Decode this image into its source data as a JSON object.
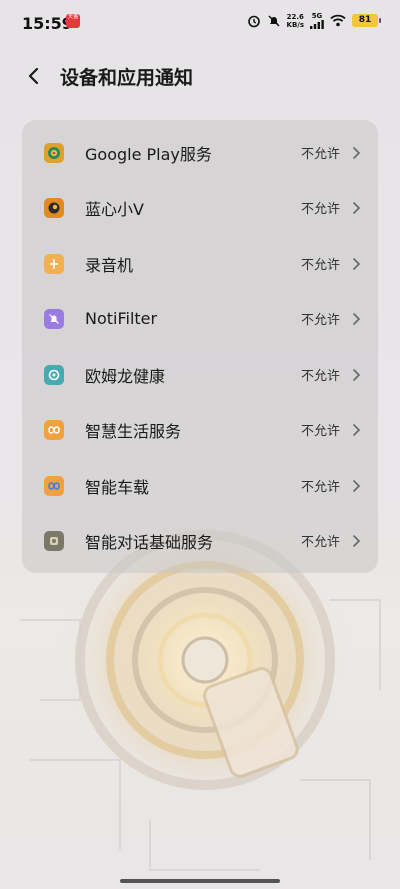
{
  "status_bar": {
    "time": "15:59",
    "notif_app_label": "天猫",
    "net_speed_value": "22.6",
    "net_speed_unit": "KB/s",
    "net_type": "5G",
    "battery": "81",
    "icons": [
      "alarm-icon",
      "mute-icon",
      "signal-icon",
      "wifi-icon"
    ]
  },
  "header": {
    "title": "设备和应用通知",
    "back_icon": "chevron-left-icon"
  },
  "apps": [
    {
      "name": "Google Play服务",
      "status": "不允许",
      "icon": "google-play-services-icon",
      "icon_color": "#2a8a5a"
    },
    {
      "name": "蓝心小V",
      "status": "不允许",
      "icon": "bluehearts-icon",
      "icon_color": "#e08a20"
    },
    {
      "name": "录音机",
      "status": "不允许",
      "icon": "recorder-icon",
      "icon_color": "#f0a040"
    },
    {
      "name": "NotiFilter",
      "status": "不允许",
      "icon": "notifilter-icon",
      "icon_color": "#8f6fd6"
    },
    {
      "name": "欧姆龙健康",
      "status": "不允许",
      "icon": "omron-health-icon",
      "icon_color": "#38a0a8"
    },
    {
      "name": "智慧生活服务",
      "status": "不允许",
      "icon": "smart-life-icon",
      "icon_color": "#3a7de0"
    },
    {
      "name": "智能车载",
      "status": "不允许",
      "icon": "smart-car-icon",
      "icon_color": "#3a7de0"
    },
    {
      "name": "智能对话基础服务",
      "status": "不允许",
      "icon": "smart-dialog-icon",
      "icon_color": "#7a7a66"
    }
  ]
}
